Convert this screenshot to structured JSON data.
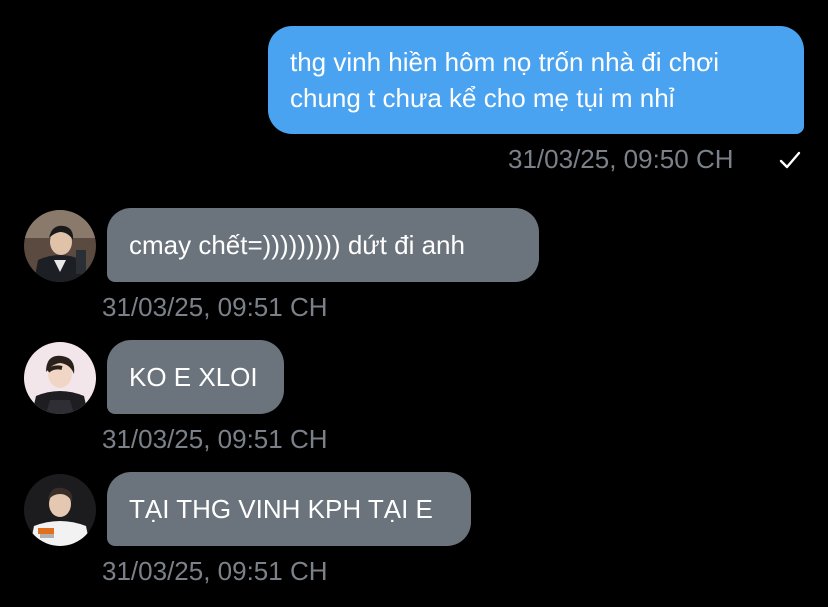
{
  "outgoing": {
    "lines": [
      "thg vinh hiền hôm nọ trốn nhà đi chơi",
      "chung t chưa kể cho mẹ tụi m nhỉ"
    ],
    "timestamp": "31/03/25, 09:50 CH",
    "status_icon": "check-icon",
    "bubble_color": "#4aa3f0"
  },
  "incoming": [
    {
      "text": "cmay chết=))))))))) dứt đi anh",
      "timestamp": "31/03/25, 09:51 CH",
      "avatar_icon": "avatar-man-suit"
    },
    {
      "text": "KO E XLOI",
      "timestamp": "31/03/25, 09:51 CH",
      "avatar_icon": "avatar-man-pink-bg"
    },
    {
      "text": "TẠI THG VINH KPH TẠI E",
      "timestamp": "31/03/25, 09:51 CH",
      "avatar_icon": "avatar-man-hle-jersey"
    }
  ],
  "colors": {
    "background": "#000000",
    "incoming_bubble": "#6b747d",
    "timestamp_text": "#7b8189"
  }
}
